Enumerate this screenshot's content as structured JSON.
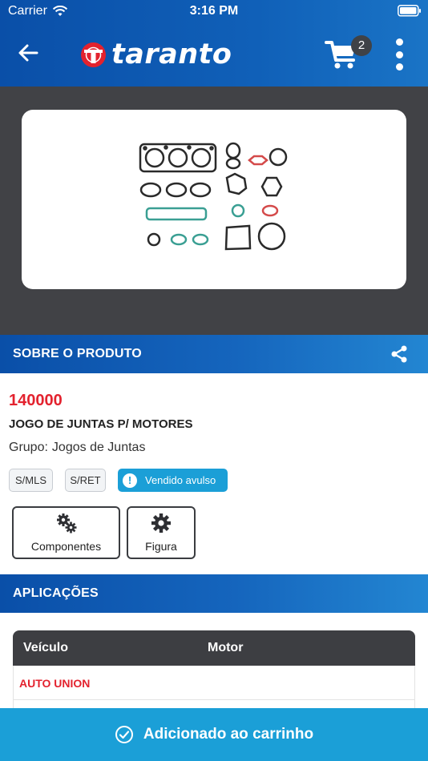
{
  "status_bar": {
    "carrier": "Carrier",
    "time": "3:16 PM"
  },
  "header": {
    "brand": "taranto",
    "cart_count": "2"
  },
  "product_section": {
    "title": "SOBRE O PRODUTO"
  },
  "product": {
    "code": "140000",
    "name": "JOGO DE JUNTAS P/ MOTORES",
    "group_label": "Grupo:",
    "group_value": "Jogos de Juntas",
    "tags": [
      "S/MLS",
      "S/RET"
    ],
    "info_tag": "Vendido avulso",
    "actions": {
      "components": "Componentes",
      "figure": "Figura"
    }
  },
  "applications": {
    "title": "APLICAÇÕES",
    "columns": {
      "vehicle": "Veículo",
      "motor": "Motor"
    },
    "rows": [
      {
        "brand": "AUTO UNION"
      }
    ]
  },
  "toast": {
    "message": "Adicionado ao carrinho"
  },
  "colors": {
    "primary": "#0a4fa8",
    "accent_red": "#e3222e",
    "info_blue": "#1b9fd7",
    "dark": "#414246"
  }
}
